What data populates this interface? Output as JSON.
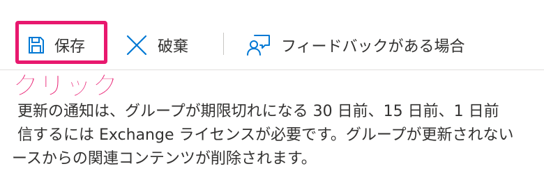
{
  "toolbar": {
    "save_label": "保存",
    "discard_label": "破棄",
    "feedback_label": "フィードバックがある場合"
  },
  "annotation": {
    "click_label": "クリック",
    "highlight_color": "#e8186e"
  },
  "description": {
    "line1": "更新の通知は、グループが期限切れになる 30 日前、15 日前、1 日前",
    "line2": "信するには Exchange ライセンスが必要です。グループが更新されない",
    "line3": "ースからの関連コンテンツが削除されます。"
  },
  "colors": {
    "icon_blue": "#0078d4",
    "text": "#323130",
    "divider": "#c8c6c4"
  },
  "icons": [
    "save-icon",
    "discard-icon",
    "feedback-icon"
  ]
}
